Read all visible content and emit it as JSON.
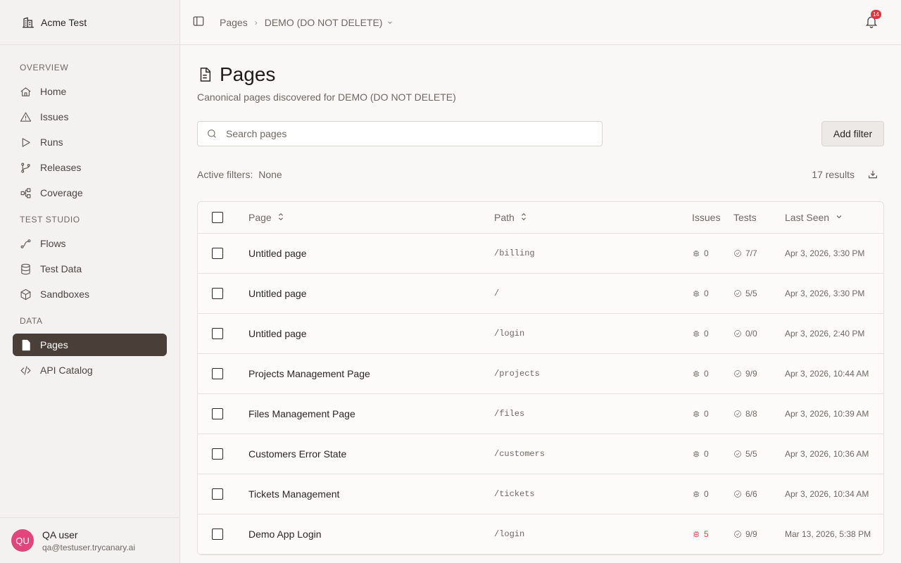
{
  "workspace": {
    "name": "Acme Test"
  },
  "sidebar": {
    "sections": [
      {
        "label": "OVERVIEW",
        "items": [
          {
            "label": "Home",
            "icon": "home-icon"
          },
          {
            "label": "Issues",
            "icon": "warning-icon"
          },
          {
            "label": "Runs",
            "icon": "play-icon"
          },
          {
            "label": "Releases",
            "icon": "git-branch-icon"
          },
          {
            "label": "Coverage",
            "icon": "nodes-icon"
          }
        ]
      },
      {
        "label": "TEST STUDIO",
        "items": [
          {
            "label": "Flows",
            "icon": "flow-icon"
          },
          {
            "label": "Test Data",
            "icon": "database-icon"
          },
          {
            "label": "Sandboxes",
            "icon": "box-icon"
          }
        ]
      },
      {
        "label": "DATA",
        "items": [
          {
            "label": "Pages",
            "icon": "page-icon",
            "active": true
          },
          {
            "label": "API Catalog",
            "icon": "code-icon"
          }
        ]
      }
    ]
  },
  "user": {
    "initials": "QU",
    "name": "QA user",
    "email": "qa@testuser.trycanary.ai"
  },
  "header": {
    "breadcrumb": [
      "Pages",
      "DEMO (DO NOT DELETE)"
    ],
    "notification_count": "14"
  },
  "page": {
    "title": "Pages",
    "subtitle": "Canonical pages discovered for DEMO (DO NOT DELETE)",
    "search_placeholder": "Search pages",
    "add_filter_label": "Add filter",
    "active_filters_label": "Active filters:",
    "active_filters_value": "None",
    "results": "17 results"
  },
  "table": {
    "columns": {
      "page": "Page",
      "path": "Path",
      "issues": "Issues",
      "tests": "Tests",
      "last_seen": "Last Seen"
    },
    "rows": [
      {
        "page": "Untitled page",
        "path": "/billing",
        "issues": "0",
        "tests": "7/7",
        "last_seen": "Apr 3, 2026, 3:30 PM"
      },
      {
        "page": "Untitled page",
        "path": "/",
        "issues": "0",
        "tests": "5/5",
        "last_seen": "Apr 3, 2026, 3:30 PM"
      },
      {
        "page": "Untitled page",
        "path": "/login",
        "issues": "0",
        "tests": "0/0",
        "last_seen": "Apr 3, 2026, 2:40 PM"
      },
      {
        "page": "Projects Management Page",
        "path": "/projects",
        "issues": "0",
        "tests": "9/9",
        "last_seen": "Apr 3, 2026, 10:44 AM"
      },
      {
        "page": "Files Management Page",
        "path": "/files",
        "issues": "0",
        "tests": "8/8",
        "last_seen": "Apr 3, 2026, 10:39 AM"
      },
      {
        "page": "Customers Error State",
        "path": "/customers",
        "issues": "0",
        "tests": "5/5",
        "last_seen": "Apr 3, 2026, 10:36 AM"
      },
      {
        "page": "Tickets Management",
        "path": "/tickets",
        "issues": "0",
        "tests": "6/6",
        "last_seen": "Apr 3, 2026, 10:34 AM"
      },
      {
        "page": "Demo App Login",
        "path": "/login",
        "issues": "5",
        "tests": "9/9",
        "last_seen": "Mar 13, 2026, 5:38 PM",
        "issues_alert": true
      }
    ]
  },
  "colors": {
    "accent": "#4a3f38",
    "alert": "#d9434f",
    "avatar": "#e0457b",
    "badge": "#e2343f"
  }
}
